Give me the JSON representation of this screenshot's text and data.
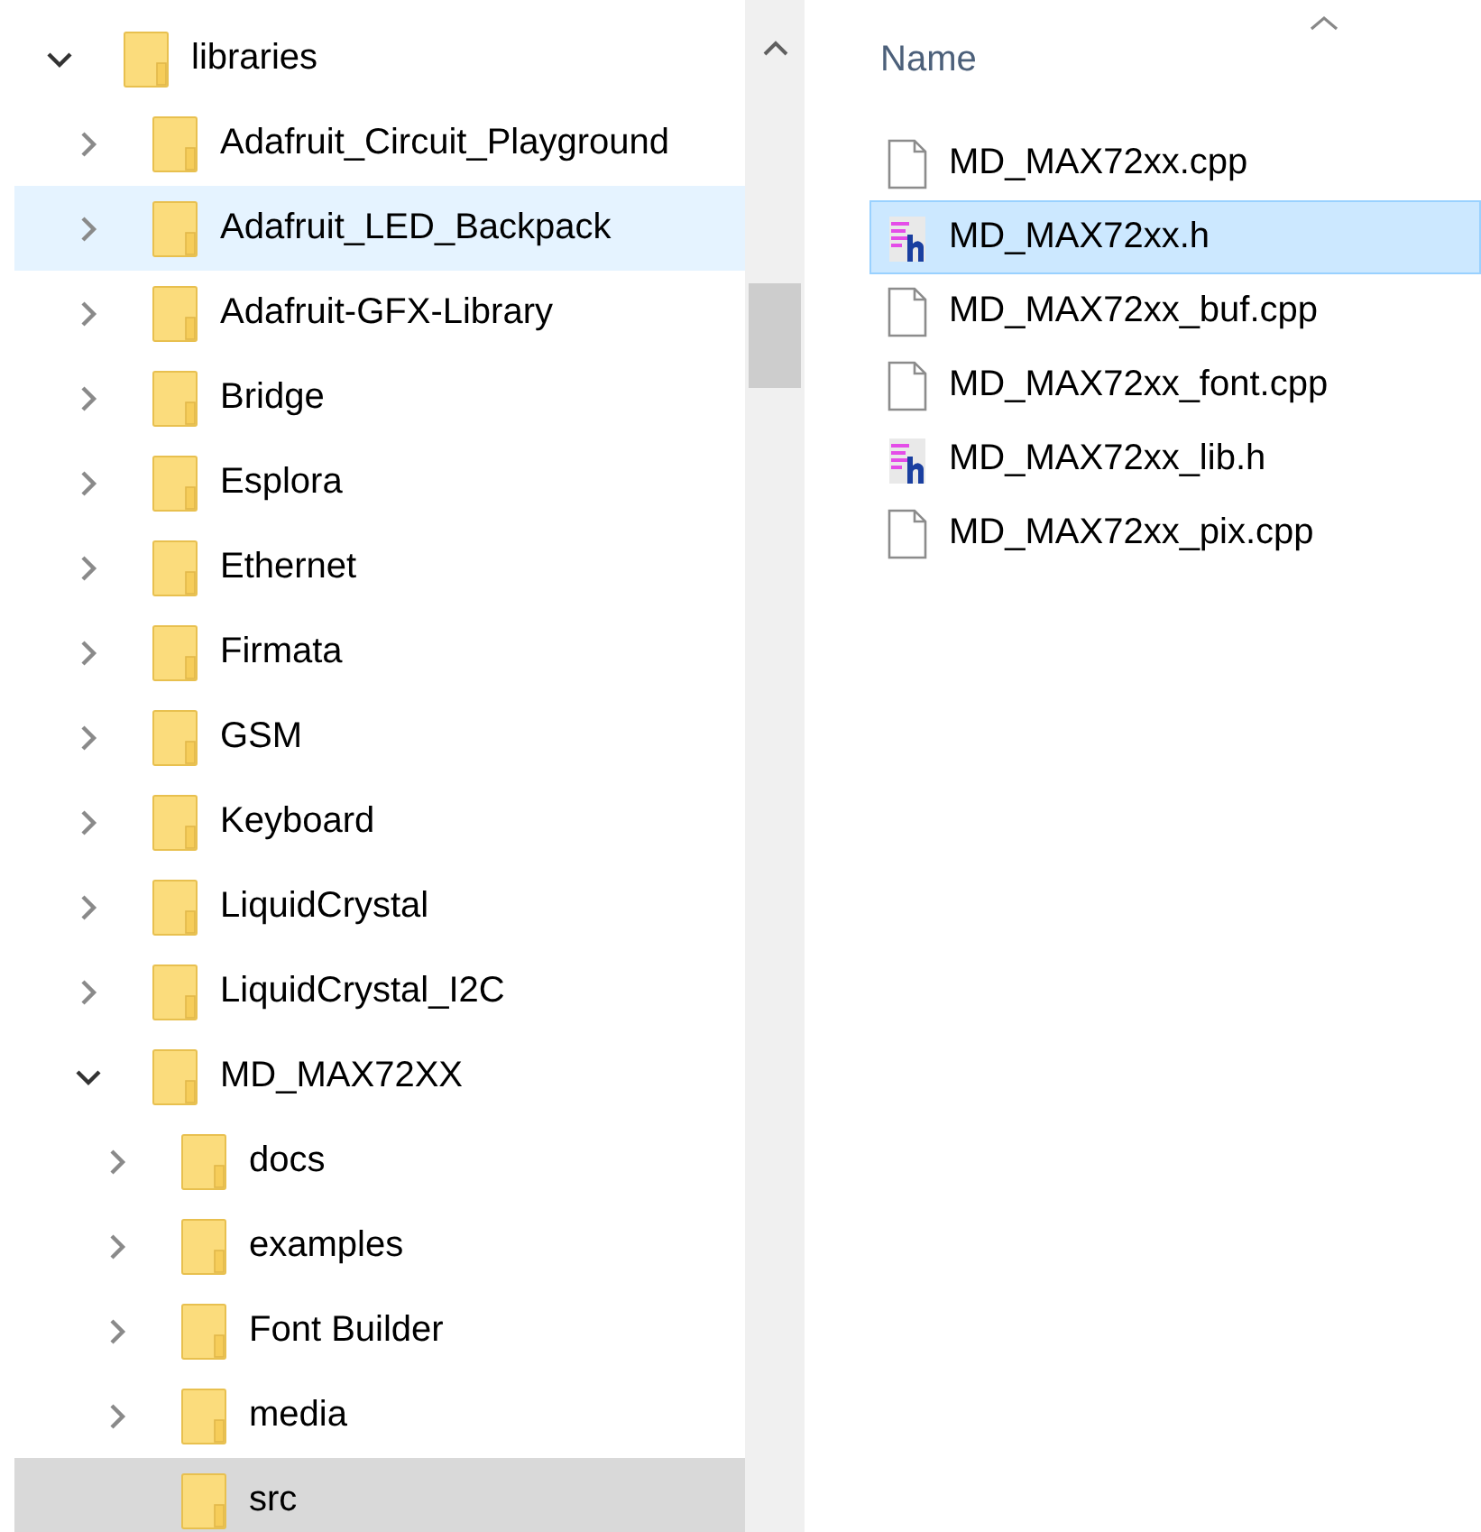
{
  "navigation_pane": {
    "items": [
      {
        "label": "libraries",
        "expandable": true,
        "expanded": true,
        "selected": false,
        "hovered": false,
        "children": [
          {
            "label": "Adafruit_Circuit_Playground",
            "expandable": true,
            "expanded": false,
            "selected": false,
            "hovered": false
          },
          {
            "label": "Adafruit_LED_Backpack",
            "expandable": true,
            "expanded": false,
            "selected": false,
            "hovered": true
          },
          {
            "label": "Adafruit-GFX-Library",
            "expandable": true,
            "expanded": false,
            "selected": false,
            "hovered": false
          },
          {
            "label": "Bridge",
            "expandable": true,
            "expanded": false,
            "selected": false,
            "hovered": false
          },
          {
            "label": "Esplora",
            "expandable": true,
            "expanded": false,
            "selected": false,
            "hovered": false
          },
          {
            "label": "Ethernet",
            "expandable": true,
            "expanded": false,
            "selected": false,
            "hovered": false
          },
          {
            "label": "Firmata",
            "expandable": true,
            "expanded": false,
            "selected": false,
            "hovered": false
          },
          {
            "label": "GSM",
            "expandable": true,
            "expanded": false,
            "selected": false,
            "hovered": false
          },
          {
            "label": "Keyboard",
            "expandable": true,
            "expanded": false,
            "selected": false,
            "hovered": false
          },
          {
            "label": "LiquidCrystal",
            "expandable": true,
            "expanded": false,
            "selected": false,
            "hovered": false
          },
          {
            "label": "LiquidCrystal_I2C",
            "expandable": true,
            "expanded": false,
            "selected": false,
            "hovered": false
          },
          {
            "label": "MD_MAX72XX",
            "expandable": true,
            "expanded": true,
            "selected": false,
            "hovered": false,
            "children": [
              {
                "label": "docs",
                "expandable": true,
                "expanded": false,
                "selected": false,
                "hovered": false
              },
              {
                "label": "examples",
                "expandable": true,
                "expanded": false,
                "selected": false,
                "hovered": false
              },
              {
                "label": "Font Builder",
                "expandable": true,
                "expanded": false,
                "selected": false,
                "hovered": false
              },
              {
                "label": "media",
                "expandable": true,
                "expanded": false,
                "selected": false,
                "hovered": false
              },
              {
                "label": "src",
                "expandable": false,
                "expanded": false,
                "selected": true,
                "hovered": false
              }
            ]
          }
        ]
      }
    ]
  },
  "file_list": {
    "columns": [
      {
        "label": "Name"
      }
    ],
    "files": [
      {
        "name": "MD_MAX72xx.cpp",
        "kind": "source",
        "selected": false
      },
      {
        "name": "MD_MAX72xx.h",
        "kind": "header",
        "selected": true
      },
      {
        "name": "MD_MAX72xx_buf.cpp",
        "kind": "source",
        "selected": false
      },
      {
        "name": "MD_MAX72xx_font.cpp",
        "kind": "source",
        "selected": false
      },
      {
        "name": "MD_MAX72xx_lib.h",
        "kind": "header",
        "selected": false
      },
      {
        "name": "MD_MAX72xx_pix.cpp",
        "kind": "source",
        "selected": false
      }
    ]
  }
}
